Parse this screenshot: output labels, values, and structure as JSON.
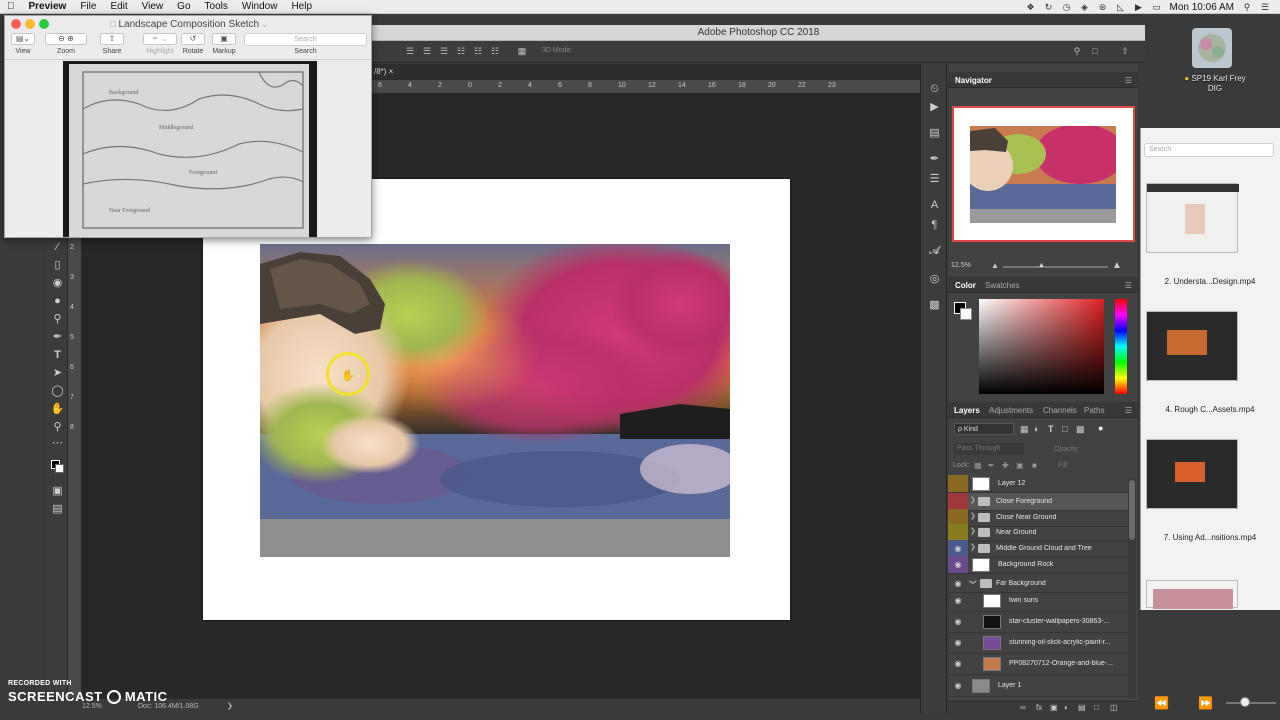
{
  "menubar": {
    "apple": "",
    "app_name": "Preview",
    "items": [
      "File",
      "Edit",
      "View",
      "Go",
      "Tools",
      "Window",
      "Help"
    ],
    "clock": "Mon 10:06 AM"
  },
  "photoshop": {
    "window_title": "Adobe Photoshop CC 2018",
    "tab_title": "/8*) ×",
    "options_mode": "3D Mode:",
    "ruler_top": [
      "6",
      "4",
      "2",
      "0",
      "2",
      "4",
      "6",
      "8",
      "10",
      "12",
      "14",
      "16",
      "18",
      "20",
      "22",
      "23"
    ],
    "ruler_left": [
      "1",
      "2",
      "3",
      "4",
      "5",
      "6",
      "7",
      "8"
    ],
    "status_zoom": "12.5%",
    "status_doc": "Doc: 106.4M/1.08G"
  },
  "navigator": {
    "title": "Navigator",
    "zoom": "12.5%"
  },
  "color_panel": {
    "tab_color": "Color",
    "tab_swatches": "Swatches"
  },
  "layers_panel": {
    "tabs": [
      "Layers",
      "Adjustments",
      "Channels",
      "Paths"
    ],
    "filter_kind": "ρ Kind",
    "blend_mode": "Pass Through",
    "opacity_label": "Opacity:",
    "lock_label": "Lock:",
    "fill_label": "Fill:",
    "layers": [
      {
        "name": "Layer 12",
        "type": "layer",
        "color": "#8a6a20",
        "visible": false
      },
      {
        "name": "Close Foreground",
        "type": "group",
        "color": "#a03a3a",
        "visible": false
      },
      {
        "name": "Close Near Ground",
        "type": "group",
        "color": "#8a6a20",
        "visible": false
      },
      {
        "name": "Near Ground",
        "type": "group",
        "color": "#8a7a20",
        "visible": false
      },
      {
        "name": "Middle Ground Cloud and Tree",
        "type": "group",
        "color": "#4a5a8a",
        "visible": true
      },
      {
        "name": "Background Rock",
        "type": "layer",
        "color": "#6a4a8a",
        "visible": true
      },
      {
        "name": "Far Background",
        "type": "group-open",
        "color": "",
        "visible": true
      },
      {
        "name": "twin suns",
        "type": "layer-indent",
        "color": "",
        "visible": true
      },
      {
        "name": "star-cluster-wallpapers-30863-...",
        "type": "layer-indent",
        "color": "",
        "visible": true
      },
      {
        "name": "stunning-oil-slick-acrylic-paint-r...",
        "type": "layer-indent",
        "color": "",
        "visible": true
      },
      {
        "name": "PP08270712-Orange-and-blue-...",
        "type": "layer-indent",
        "color": "",
        "visible": true
      },
      {
        "name": "Layer 1",
        "type": "layer",
        "color": "",
        "visible": true
      }
    ]
  },
  "preview": {
    "title": "Landscape Composition Sketch",
    "toolbar": [
      "View",
      "Zoom",
      "Share",
      "Highlight",
      "Rotate",
      "Markup"
    ],
    "search_placeholder": "Search",
    "search_label": "Search",
    "sketch_labels": [
      "Background",
      "Middleground",
      "Foreground",
      "Near Foreground"
    ]
  },
  "desktop": {
    "icon_label_1": "SP19 Karl Frey",
    "icon_label_2": "DIG"
  },
  "finder": {
    "search_placeholder": "Search",
    "videos": [
      "2. Understa...Design.mp4",
      "4. Rough C...Assets.mp4",
      "7. Using Ad...nsitions.mp4"
    ]
  },
  "watermark": {
    "recorded_with": "RECORDED WITH",
    "brand_left": "SCREENCAST",
    "brand_right": "MATIC"
  }
}
